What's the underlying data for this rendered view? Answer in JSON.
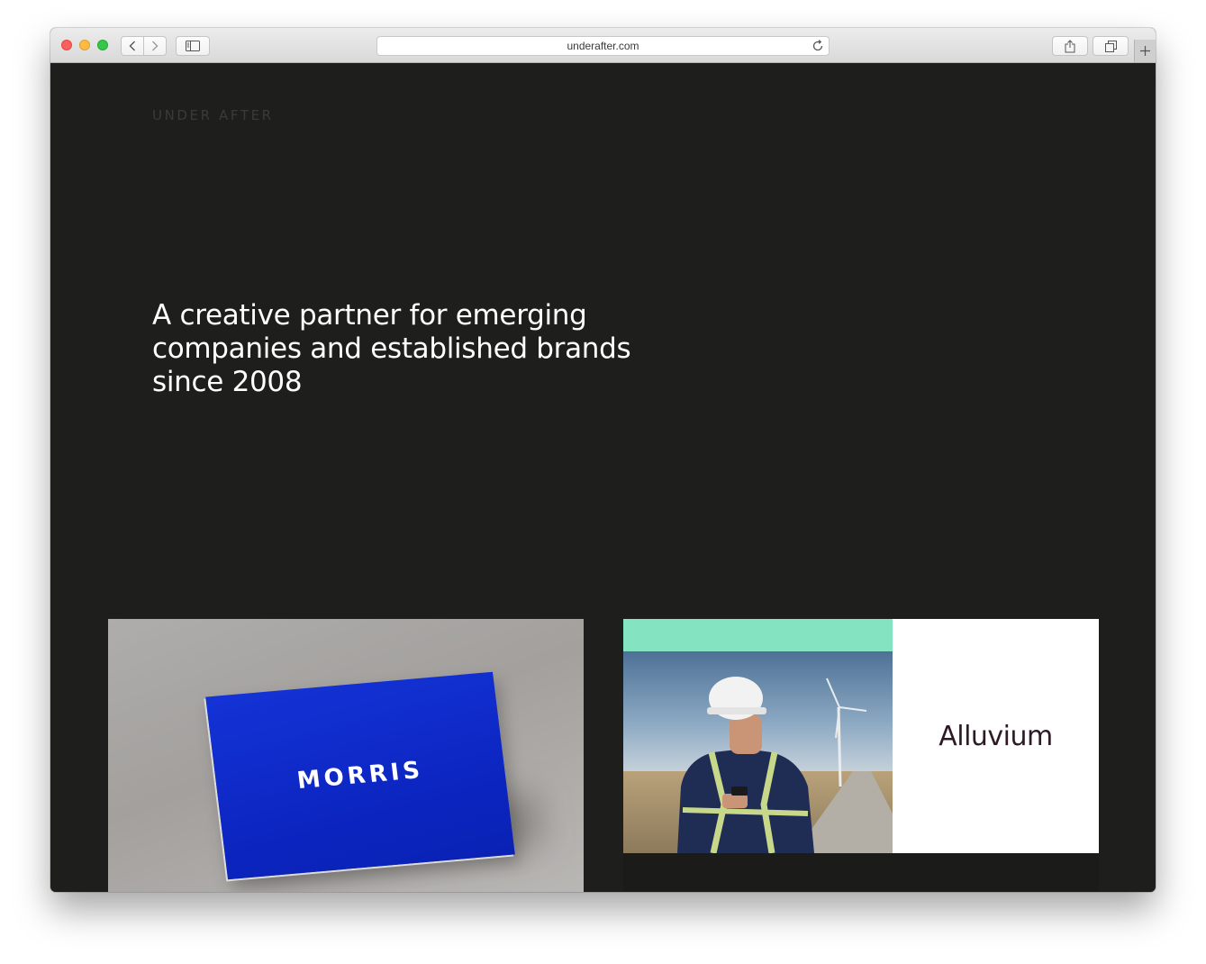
{
  "browser": {
    "url": "underafter.com"
  },
  "site": {
    "logo": "UNDER AFTER",
    "hero_line1": "A creative partner for emerging",
    "hero_line2": "companies and established brands",
    "hero_line3": "since 2008"
  },
  "projects": [
    {
      "brand": "MORRIS",
      "color": "#0b24bf"
    },
    {
      "brand": "Alluvium",
      "accent": "#84e3c1",
      "text_color": "#2d1a26"
    }
  ],
  "colors": {
    "page_bg": "#1e1f1c",
    "hero_text": "#ffffff",
    "logo_text": "#3a3b37"
  }
}
